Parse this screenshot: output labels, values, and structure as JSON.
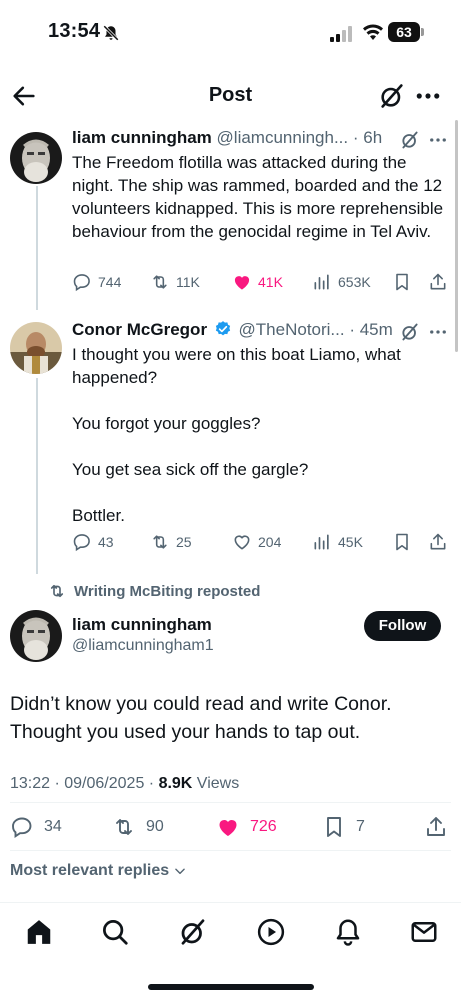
{
  "status_bar": {
    "time": "13:54",
    "battery": "63"
  },
  "header": {
    "title": "Post"
  },
  "tweets": [
    {
      "name": "liam cunningham",
      "handle": "@liamcunningh...",
      "time": "· 6h",
      "paragraphs": [
        "The Freedom flotilla was attacked during the night. The ship was rammed, boarded and the 12 volunteers kidnapped. This is more reprehensible behaviour from the genocidal regime in Tel Aviv."
      ],
      "replies": "744",
      "reposts": "11K",
      "likes": "41K",
      "views": "653K",
      "liked": true
    },
    {
      "name": "Conor McGregor",
      "handle": "@TheNotori...",
      "time": "· 45m",
      "verified": true,
      "paragraphs": [
        "I thought you were on this boat Liamo, what happened?",
        "You forgot your goggles?",
        "You get sea sick off the gargle?",
        "Bottler."
      ],
      "replies": "43",
      "reposts": "25",
      "likes": "204",
      "views": "45K",
      "liked": false
    }
  ],
  "repost_notice": "Writing McBiting reposted",
  "main_post": {
    "name": "liam cunningham",
    "handle": "@liamcunningham1",
    "follow_label": "Follow",
    "text": "Didn’t know you could read and write Conor. Thought you used your hands to tap out.",
    "timestamp": "13:22 · 09/06/2025 · ",
    "views_count": "8.9K",
    "views_label": " Views",
    "replies": "34",
    "reposts": "90",
    "likes": "726",
    "bookmarks": "7"
  },
  "replies_sort_label": "Most relevant replies",
  "colors": {
    "text": "#0f1419",
    "secondary": "#536471",
    "like_pink": "#f91880",
    "verified_blue": "#1d9bf0",
    "divider": "#eff3f4"
  },
  "icons": {
    "status": [
      "bell-off-icon",
      "signal-icon",
      "wifi-icon",
      "battery-icon"
    ],
    "header": [
      "back-arrow-icon",
      "grok-icon",
      "more-icon"
    ],
    "tab_bar": [
      "home-icon",
      "search-icon",
      "grok-icon",
      "play-icon",
      "notifications-icon",
      "messages-icon"
    ]
  }
}
